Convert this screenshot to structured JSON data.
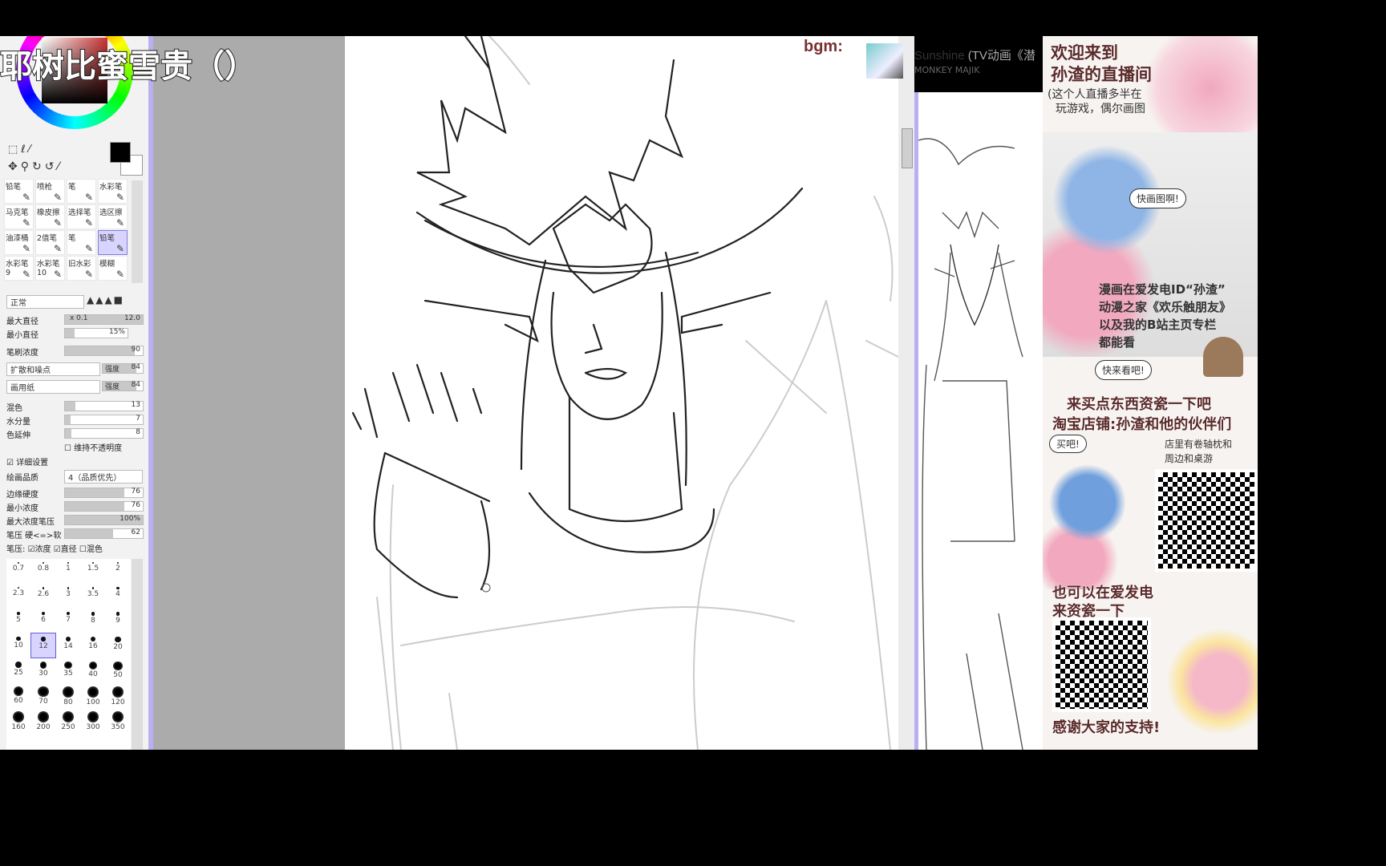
{
  "stream_title": "耶树比蜜雪贵（）",
  "bgm": {
    "label": "bgm:",
    "song": "Sunshine",
    "song_extra": "(TV动画《潜",
    "artist": "MONKEY MAJIK"
  },
  "tools": [
    {
      "label": "铅笔"
    },
    {
      "label": "喷枪"
    },
    {
      "label": "笔"
    },
    {
      "label": "水彩笔"
    },
    {
      "label": "马克笔"
    },
    {
      "label": "橡皮擦"
    },
    {
      "label": "选择笔"
    },
    {
      "label": "选区擦"
    },
    {
      "label": "油漆桶"
    },
    {
      "label": "2值笔"
    },
    {
      "label": "笔"
    },
    {
      "label": "铅笔",
      "selected": true
    },
    {
      "label": "水彩笔9"
    },
    {
      "label": "水彩笔10"
    },
    {
      "label": "旧水彩"
    },
    {
      "label": "模糊"
    }
  ],
  "brush": {
    "blend_mode": "正常",
    "max_diameter": {
      "label": "最大直径",
      "mult": "x 0.1",
      "value": "12.0"
    },
    "min_diameter": {
      "label": "最小直径",
      "value": "15%"
    },
    "density": {
      "label": "笔刷浓度",
      "value": "90"
    },
    "texture1": {
      "value": "扩散和噪点",
      "strength_label": "强度",
      "strength": "84"
    },
    "texture2": {
      "value": "画用纸",
      "strength_label": "强度",
      "strength": "84"
    },
    "blending": {
      "label": "混色",
      "value": "13"
    },
    "dilution": {
      "label": "水分量",
      "value": "7"
    },
    "persistence": {
      "label": "色延伸",
      "value": "8"
    },
    "keep_opacity": "维持不透明度",
    "advanced": "详细设置",
    "quality": {
      "label": "绘画品质",
      "value": "4（品质优先）"
    },
    "edge_hardness": {
      "label": "边缘硬度",
      "value": "76"
    },
    "min_density": {
      "label": "最小浓度",
      "value": "76"
    },
    "max_density_pressure": {
      "label": "最大浓度笔压",
      "value": "100%"
    },
    "pressure_hardness": {
      "label": "笔压 硬<=>软",
      "value": "62"
    },
    "pressure_label": "笔压:",
    "pressure_density": "浓度",
    "pressure_size": "直径",
    "pressure_blend": "混色"
  },
  "sizes": [
    "0.7",
    "0.8",
    "1",
    "1.5",
    "2",
    "2.3",
    "2.6",
    "3",
    "3.5",
    "4",
    "5",
    "6",
    "7",
    "8",
    "9",
    "10",
    "12",
    "14",
    "16",
    "20",
    "25",
    "30",
    "35",
    "40",
    "50",
    "60",
    "70",
    "80",
    "100",
    "120",
    "160",
    "200",
    "250",
    "300",
    "350"
  ],
  "selected_size": "12",
  "promo": {
    "welcome1": "欢迎来到",
    "welcome2": "孙渣的直播间",
    "intro1": "(这个人直播多半在",
    "intro2": "玩游戏，偶尔画图",
    "bubble1": "快画图啊!",
    "manga1": "漫画在爱发电ID“孙渣”",
    "manga2": "动漫之家《欢乐触朋友》",
    "manga3": "以及我的B站主页专栏",
    "manga4": "都能看",
    "bubble2": "快来看吧!",
    "shop1": "来买点东西资瓷一下吧",
    "shop2": "淘宝店铺:孙渣和他的伙伴们",
    "bubble3": "买吧!",
    "shop3": "店里有卷轴枕和",
    "shop4": "周边和桌游",
    "afdian1": "也可以在爱发电",
    "afdian2": "来资瓷一下",
    "thanks": "感谢大家的支持!"
  },
  "colors": {
    "accent": "#b8b0f0",
    "selection": "#d8d4ff",
    "promo_text": "#5a2a2a",
    "primary_color": "#000000",
    "secondary_color": "#ffffff"
  }
}
